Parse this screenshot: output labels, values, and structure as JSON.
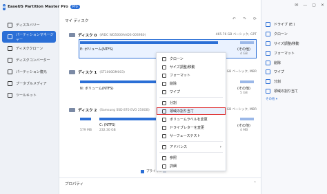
{
  "app": {
    "title": "EaseUS Partition Master Pro",
    "badge": "Pro"
  },
  "sidebar": {
    "items": [
      {
        "label": "ディスカバリー",
        "active": false
      },
      {
        "label": "パーティションマネージャー",
        "active": true
      },
      {
        "label": "ディスククローン",
        "active": false
      },
      {
        "label": "ディスクコンバーター",
        "active": false
      },
      {
        "label": "パーティション復元",
        "active": false
      },
      {
        "label": "ブータブルメディア",
        "active": false
      },
      {
        "label": "ツールキット",
        "active": false
      }
    ]
  },
  "main": {
    "section_title": "マイ ディスク",
    "disks": [
      {
        "name": "ディスク 0",
        "model": "(WDC WD5000AADS-00S9B0)",
        "meta": "465.76 GB ベーシック, GPT",
        "partition_label": "E: ボリューム(NTFS)",
        "extra": "(その他)",
        "extra_size": "4 GB"
      },
      {
        "name": "ディスク 1",
        "model": "(ST1000DM003)",
        "meta": "931.51 GB ベーシック, MBR",
        "partition_label": "N: ボリューム(NTFS)",
        "extra": "(その他)",
        "extra_size": "5 GB"
      },
      {
        "name": "ディスク 2",
        "model": "(Samsung SSD 870 EVO 250GB)",
        "meta": "232.89 GB ベーシック, MBR",
        "partition_label": "C: (NTFS)",
        "size1": "579 MB",
        "size2": "232.30 GB",
        "extra": "(その他)",
        "extra_size": "4 MB"
      }
    ],
    "legend": {
      "primary": "プライマ...",
      "unallocated": "..."
    },
    "properties": "プロパティ"
  },
  "context_menu": {
    "items": [
      {
        "label": "クローン",
        "highlight": false
      },
      {
        "label": "サイズ調整/移動",
        "highlight": false
      },
      {
        "label": "フォーマット",
        "highlight": false
      },
      {
        "label": "削除",
        "highlight": false
      },
      {
        "label": "ワイプ",
        "highlight": false
      },
      {
        "label": "分割",
        "highlight": false
      },
      {
        "label": "領域の割り当て",
        "highlight": true
      },
      {
        "label": "ボリュームラベルを変更",
        "highlight": false
      },
      {
        "label": "ドライブレターを変更",
        "highlight": false
      },
      {
        "label": "サーフェーステスト",
        "highlight": false
      },
      {
        "label": "アドバンス",
        "highlight": false
      },
      {
        "label": "参照",
        "highlight": false
      },
      {
        "label": "詳細",
        "highlight": false
      }
    ]
  },
  "ops_panel": {
    "items": [
      "ドライブ (E:)",
      "クローン",
      "サイズ調整/移動",
      "フォーマット",
      "削除",
      "ワイプ",
      "分割",
      "領域の割り当て"
    ],
    "more": "その他"
  },
  "colors": {
    "accent": "#2b6fd6",
    "highlight_border": "#e03131",
    "partition_blue": "#2b6fd6",
    "partition_light": "#9bb8e8"
  }
}
